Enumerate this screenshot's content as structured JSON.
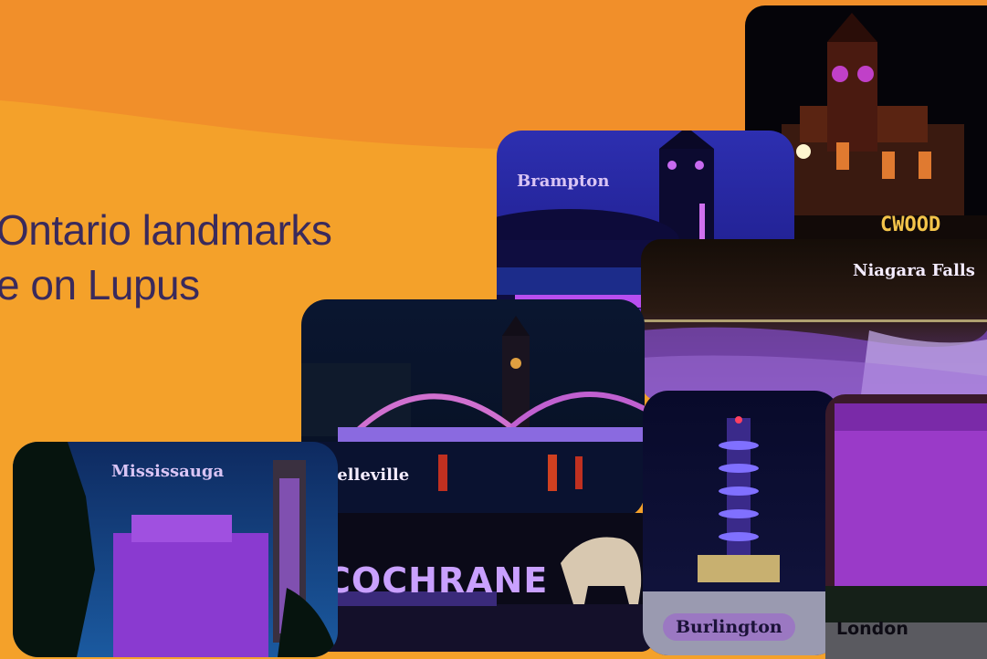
{
  "headline": {
    "line1": "Ontario landmarks",
    "line2": "e on Lupus"
  },
  "colors": {
    "background": "#f4a12a",
    "headline": "#3a2a5c",
    "accent_purple": "#9b5cf0",
    "label_pill": "#9b78c2"
  },
  "photos": [
    {
      "id": "cobourg",
      "label": "",
      "sign": "CWOOD"
    },
    {
      "id": "brampton",
      "label": "Brampton"
    },
    {
      "id": "niagara",
      "label": "Niagara Falls"
    },
    {
      "id": "belleville",
      "label": "Belleville"
    },
    {
      "id": "mississauga",
      "label": "Mississauga"
    },
    {
      "id": "cochrane",
      "label": "",
      "sign": "COCHRANE"
    },
    {
      "id": "burlington",
      "label": "Burlington"
    },
    {
      "id": "london",
      "label": "London"
    }
  ]
}
